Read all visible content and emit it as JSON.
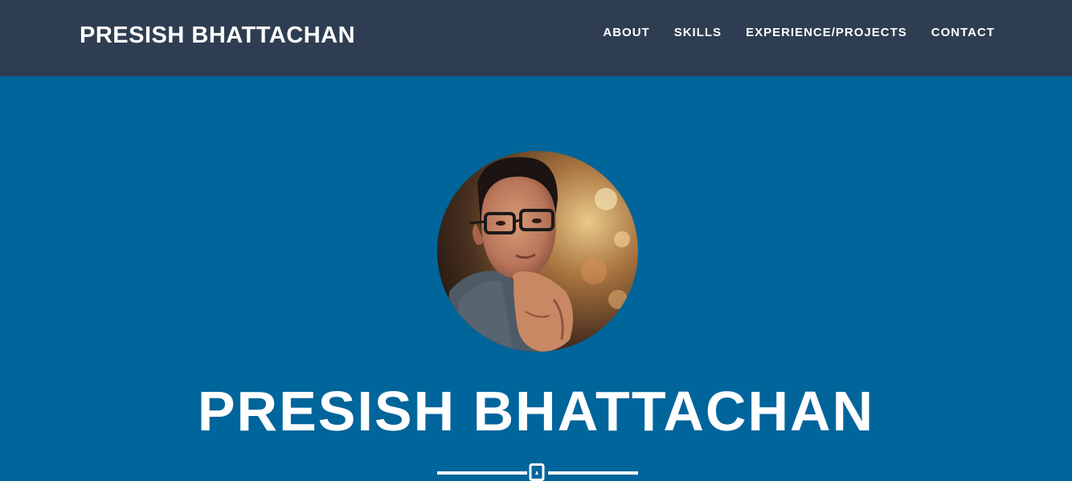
{
  "navbar": {
    "brand": "PRESISH BHATTACHAN",
    "items": [
      {
        "label": "ABOUT"
      },
      {
        "label": "SKILLS"
      },
      {
        "label": "EXPERIENCE/PROJECTS"
      },
      {
        "label": "CONTACT"
      }
    ]
  },
  "header": {
    "name": "PRESISH BHATTACHAN",
    "divider_icon": "bookmark-icon"
  },
  "colors": {
    "navbar_bg": "#2e3d51",
    "header_bg": "#00659b",
    "text": "#ffffff"
  }
}
